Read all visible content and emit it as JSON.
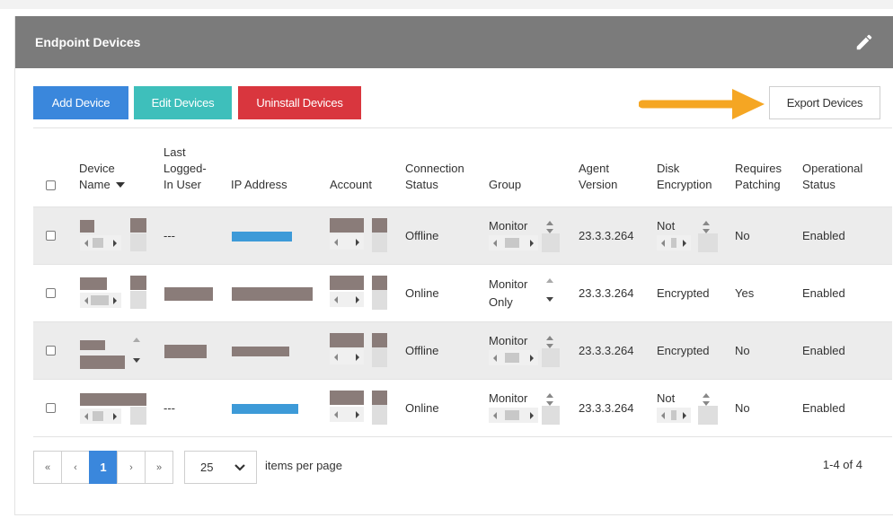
{
  "panel": {
    "title": "Endpoint Devices",
    "edit_icon": "pencil-icon"
  },
  "toolbar": {
    "add_label": "Add Device",
    "edit_label": "Edit Devices",
    "uninstall_label": "Uninstall Devices",
    "export_label": "Export Devices"
  },
  "colors": {
    "header_bg": "#7b7b7b",
    "add_btn": "#3a87dc",
    "edit_btn": "#3ebfbb",
    "uninstall_btn": "#d9363e",
    "arrow": "#f5a623",
    "redaction": "#8a7c79",
    "ip_highlight": "#3d9ad8"
  },
  "table": {
    "headers": {
      "device_name_line1": "Device",
      "device_name_line2": "Name",
      "last_user_line1": "Last",
      "last_user_line2": "Logged-",
      "last_user_line3": "In User",
      "ip": "IP Address",
      "account": "Account",
      "conn_line1": "Connection",
      "conn_line2": "Status",
      "group": "Group",
      "agent_line1": "Agent",
      "agent_line2": "Version",
      "disk_line1": "Disk",
      "disk_line2": "Encryption",
      "patch_line1": "Requires",
      "patch_line2": "Patching",
      "op_line1": "Operational",
      "op_line2": "Status"
    },
    "sort_icon": "caret-down-icon",
    "rows": [
      {
        "last_user": "---",
        "status": "Offline",
        "group_line1": "Monitor",
        "group_line2": "",
        "agent": "23.3.3.264",
        "disk_line1": "Not",
        "patching": "No",
        "op": "Enabled"
      },
      {
        "last_user": "",
        "status": "Online",
        "group_line1": "Monitor",
        "group_line2": "Only",
        "agent": "23.3.3.264",
        "disk_line1": "Encrypted",
        "patching": "Yes",
        "op": "Enabled"
      },
      {
        "last_user": "",
        "status": "Offline",
        "group_line1": "Monitor",
        "group_line2": "",
        "agent": "23.3.3.264",
        "disk_line1": "Encrypted",
        "patching": "No",
        "op": "Enabled"
      },
      {
        "last_user": "---",
        "status": "Online",
        "group_line1": "Monitor",
        "group_line2": "",
        "agent": "23.3.3.264",
        "disk_line1": "Not",
        "patching": "No",
        "op": "Enabled"
      }
    ]
  },
  "pagination": {
    "first": "«",
    "prev": "‹",
    "current": "1",
    "next": "›",
    "last": "»",
    "per_page": "25",
    "per_page_label": "items per page",
    "count": "1-4 of 4"
  }
}
